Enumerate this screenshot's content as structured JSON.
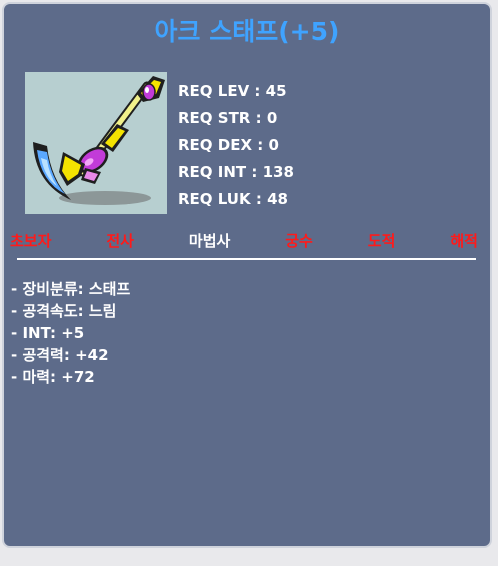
{
  "item": {
    "name": "아크 스태프(+5)",
    "icon": "staff-icon",
    "name_color": "#3fa3ff"
  },
  "requirements": [
    {
      "label": "REQ LEV",
      "value": "45"
    },
    {
      "label": "REQ STR",
      "value": "0"
    },
    {
      "label": "REQ DEX",
      "value": "0"
    },
    {
      "label": "REQ INT",
      "value": "138"
    },
    {
      "label": "REQ LUK",
      "value": "48"
    }
  ],
  "jobs": [
    {
      "label": "초보자",
      "available": false
    },
    {
      "label": "전사",
      "available": false
    },
    {
      "label": "마법사",
      "available": true
    },
    {
      "label": "궁수",
      "available": false
    },
    {
      "label": "도적",
      "available": false
    },
    {
      "label": "해적",
      "available": false
    }
  ],
  "stats": [
    "- 장비분류: 스태프",
    "- 공격속도: 느림",
    "- INT: +5",
    "- 공격력: +42",
    "- 마력: +72"
  ],
  "colors": {
    "background": "#5d6b8a",
    "job_unavailable": "#ff1a1a",
    "job_available": "#ffffff"
  }
}
